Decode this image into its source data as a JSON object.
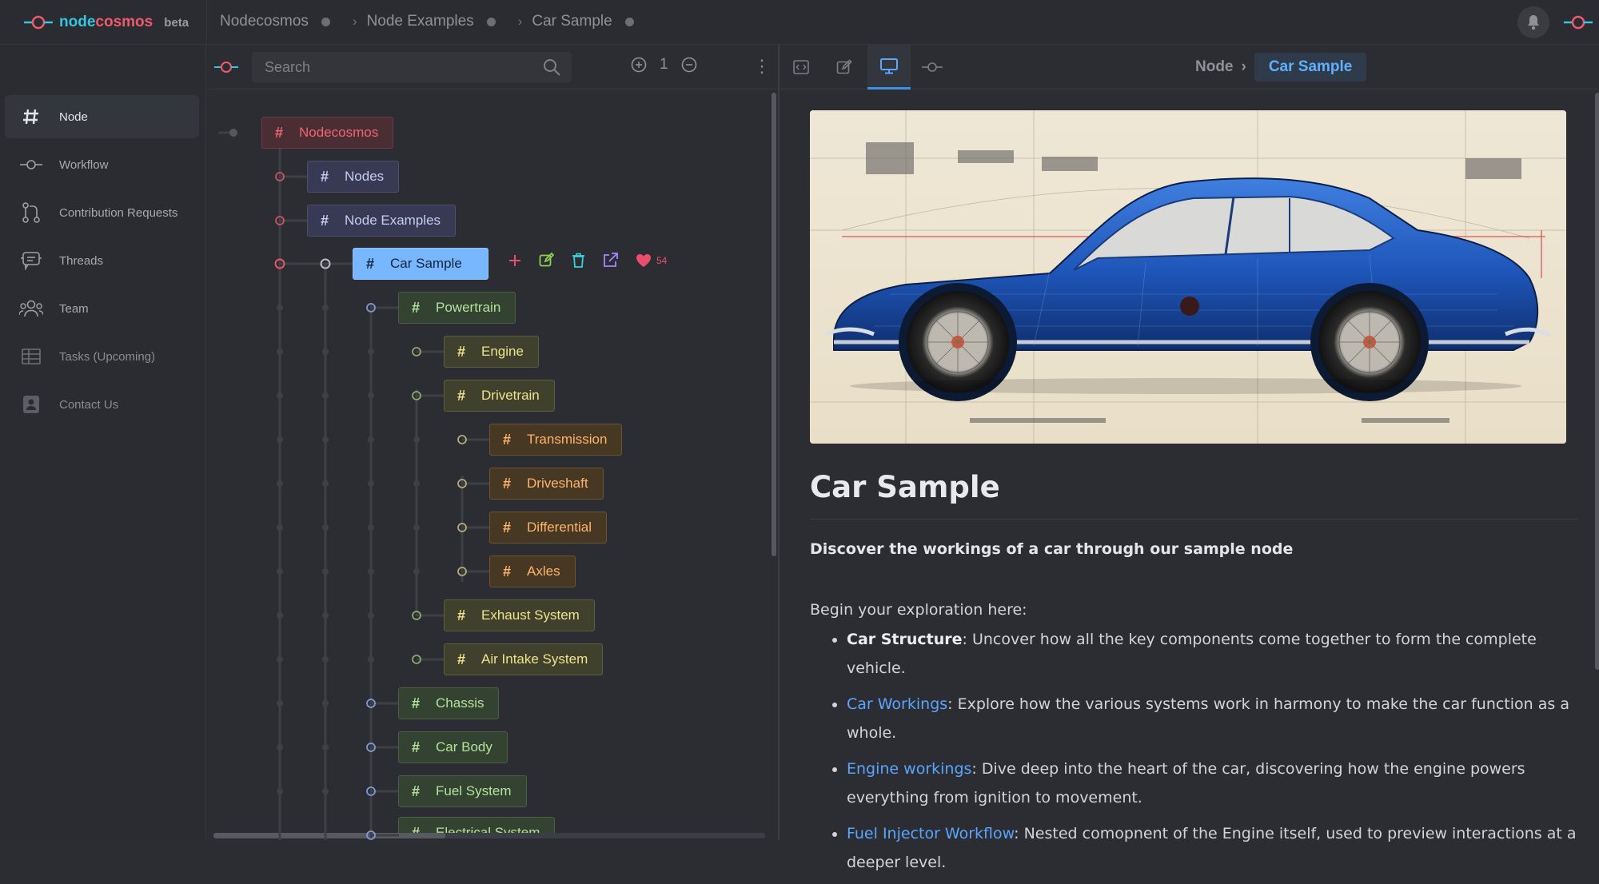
{
  "app": {
    "logo_part1": "node",
    "logo_part2": "cosmos",
    "beta": "beta",
    "accent_cyan": "#35c6e0",
    "accent_red": "#f05a6e"
  },
  "breadcrumbs": [
    "Nodecosmos",
    "Node Examples",
    "Car Sample"
  ],
  "sidebar": {
    "items": [
      {
        "label": "Node",
        "icon": "hash-icon",
        "active": true
      },
      {
        "label": "Workflow",
        "icon": "workflow-icon"
      },
      {
        "label": "Contribution Requests",
        "icon": "git-pull-request-icon"
      },
      {
        "label": "Threads",
        "icon": "threads-icon"
      },
      {
        "label": "Team",
        "icon": "team-icon"
      },
      {
        "label": "Tasks (Upcoming)",
        "icon": "table-icon"
      },
      {
        "label": "Contact Us",
        "icon": "contact-icon"
      }
    ]
  },
  "tree_toolbar": {
    "search_placeholder": "Search",
    "zoom_level": "1"
  },
  "tree": {
    "nodes": [
      {
        "label": "Nodecosmos",
        "level": 0
      },
      {
        "label": "Nodes",
        "level": 1
      },
      {
        "label": "Node Examples",
        "level": 1
      },
      {
        "label": "Car Sample",
        "level": 2,
        "selected": true
      },
      {
        "label": "Powertrain",
        "level": 3
      },
      {
        "label": "Engine",
        "level": 4
      },
      {
        "label": "Drivetrain",
        "level": 4
      },
      {
        "label": "Transmission",
        "level": 5
      },
      {
        "label": "Driveshaft",
        "level": 5
      },
      {
        "label": "Differential",
        "level": 5
      },
      {
        "label": "Axles",
        "level": 5
      },
      {
        "label": "Exhaust System",
        "level": 4
      },
      {
        "label": "Air Intake System",
        "level": 4
      },
      {
        "label": "Chassis",
        "level": 3
      },
      {
        "label": "Car Body",
        "level": 3
      },
      {
        "label": "Fuel System",
        "level": 3
      },
      {
        "label": "Electrical System",
        "level": 3
      }
    ],
    "likes": "54"
  },
  "right_pane": {
    "crumb_parent": "Node",
    "crumb_current": "Car Sample",
    "title": "Car Sample",
    "lead": "Discover the workings of a car through our sample node",
    "intro": "Begin your exploration here:",
    "bullets": [
      {
        "strong": "Car Structure",
        "text": ": Uncover how all the key components come together to form the complete vehicle."
      },
      {
        "link": "Car Workings",
        "text": ": Explore how the various systems work in harmony to make the car function as a whole."
      },
      {
        "link": "Engine workings",
        "text": ": Dive deep into the heart of the car, discovering how the engine powers everything from ignition to movement."
      },
      {
        "link": "Fuel Injector Workflow",
        "text": ": Nested comopnent of the Engine itself, used to preview interactions at a deeper level."
      }
    ]
  }
}
